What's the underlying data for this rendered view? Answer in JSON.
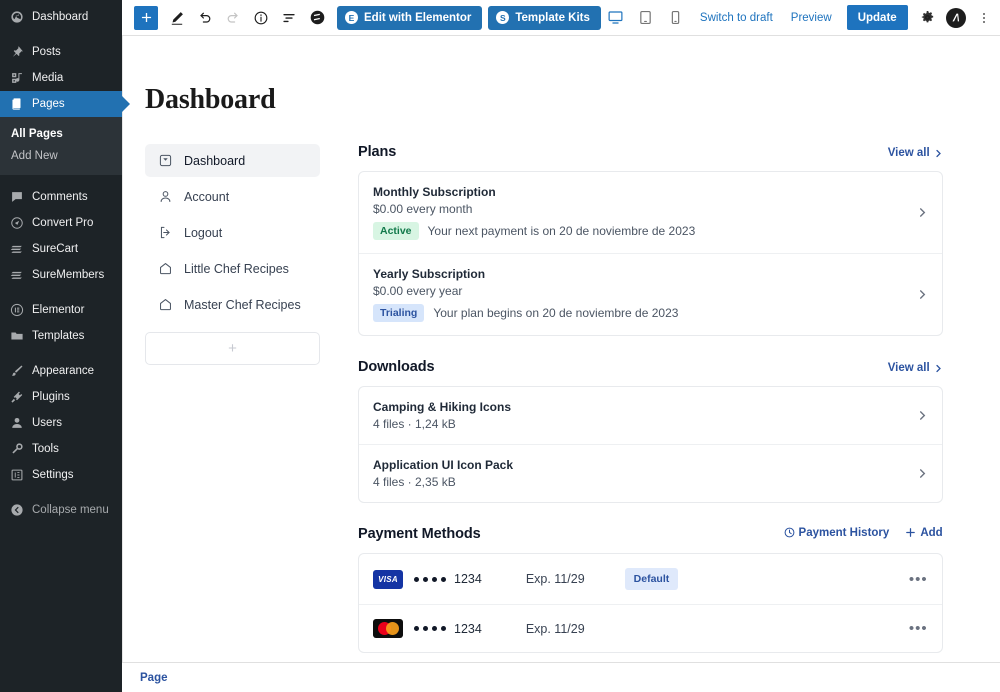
{
  "wp_sidebar": {
    "items": [
      {
        "label": "Dashboard",
        "icon": "dashboard-icon",
        "current": false
      },
      {
        "label": "Posts",
        "icon": "pin-icon",
        "current": false
      },
      {
        "label": "Media",
        "icon": "media-icon",
        "current": false
      },
      {
        "label": "Pages",
        "icon": "pages-icon",
        "current": true
      },
      {
        "label": "Comments",
        "icon": "comments-icon",
        "current": false
      },
      {
        "label": "Convert Pro",
        "icon": "convert-pro-icon",
        "current": false
      },
      {
        "label": "SureCart",
        "icon": "surecart-icon",
        "current": false
      },
      {
        "label": "SureMembers",
        "icon": "suremembers-icon",
        "current": false
      },
      {
        "label": "Elementor",
        "icon": "elementor-icon",
        "current": false
      },
      {
        "label": "Templates",
        "icon": "templates-icon",
        "current": false
      },
      {
        "label": "Appearance",
        "icon": "appearance-icon",
        "current": false
      },
      {
        "label": "Plugins",
        "icon": "plugins-icon",
        "current": false
      },
      {
        "label": "Users",
        "icon": "users-icon",
        "current": false
      },
      {
        "label": "Tools",
        "icon": "tools-icon",
        "current": false
      },
      {
        "label": "Settings",
        "icon": "settings-icon",
        "current": false
      },
      {
        "label": "Collapse menu",
        "icon": "collapse-icon",
        "current": false
      }
    ],
    "submenu": [
      {
        "label": "All Pages",
        "active": true
      },
      {
        "label": "Add New",
        "active": false
      }
    ],
    "accent": "#2271b1",
    "background": "#1d2327"
  },
  "toolbar": {
    "add_block_label": "+",
    "tools": [
      "edit-pencil-icon",
      "undo-icon",
      "redo-icon",
      "info-icon",
      "list-view-icon",
      "elementor-logo-icon"
    ],
    "edit_elementor_label": "Edit with Elementor",
    "edit_elementor_badge": "E",
    "template_kits_label": "Template Kits",
    "template_kits_badge": "S",
    "devices": [
      "desktop-icon",
      "tablet-icon",
      "mobile-icon"
    ],
    "switch_draft_label": "Switch to draft",
    "preview_label": "Preview",
    "update_label": "Update",
    "settings_icon": "gear-icon",
    "avatar_icon": "astra-avatar-icon",
    "more_icon": "kebab-menu-icon",
    "primary_color": "#1e73be"
  },
  "page": {
    "title": "Dashboard"
  },
  "dashboard_nav": {
    "items": [
      {
        "label": "Dashboard",
        "icon": "inbox-icon",
        "active": true
      },
      {
        "label": "Account",
        "icon": "user-icon",
        "active": false
      },
      {
        "label": "Logout",
        "icon": "logout-icon",
        "active": false
      },
      {
        "label": "Little Chef Recipes",
        "icon": "home-icon",
        "active": false
      },
      {
        "label": "Master Chef Recipes",
        "icon": "home-icon",
        "active": false
      }
    ],
    "add_label": "+"
  },
  "plans": {
    "title": "Plans",
    "view_all": "View all",
    "items": [
      {
        "name": "Monthly Subscription",
        "price": "$0.00 every month",
        "status": "Active",
        "status_type": "active",
        "note": "Your next payment is on 20 de noviembre de 2023"
      },
      {
        "name": "Yearly Subscription",
        "price": "$0.00 every year",
        "status": "Trialing",
        "status_type": "trial",
        "note": "Your plan begins on 20 de noviembre de 2023"
      }
    ]
  },
  "downloads": {
    "title": "Downloads",
    "view_all": "View all",
    "items": [
      {
        "name": "Camping & Hiking Icons",
        "meta": "4 files · 1,24 kB"
      },
      {
        "name": "Application UI Icon Pack",
        "meta": "4 files · 2,35 kB"
      }
    ]
  },
  "payment_methods": {
    "title": "Payment Methods",
    "history_label": "Payment History",
    "add_label": "Add",
    "items": [
      {
        "brand": "visa",
        "brand_label": "VISA",
        "mask": "••••",
        "last4": "1234",
        "expiry": "Exp. 11/29",
        "badge": "Default"
      },
      {
        "brand": "mastercard",
        "brand_label": "",
        "mask": "••••",
        "last4": "1234",
        "expiry": "Exp. 11/29",
        "badge": ""
      }
    ]
  },
  "bottom_bar": {
    "breadcrumb": "Page"
  }
}
